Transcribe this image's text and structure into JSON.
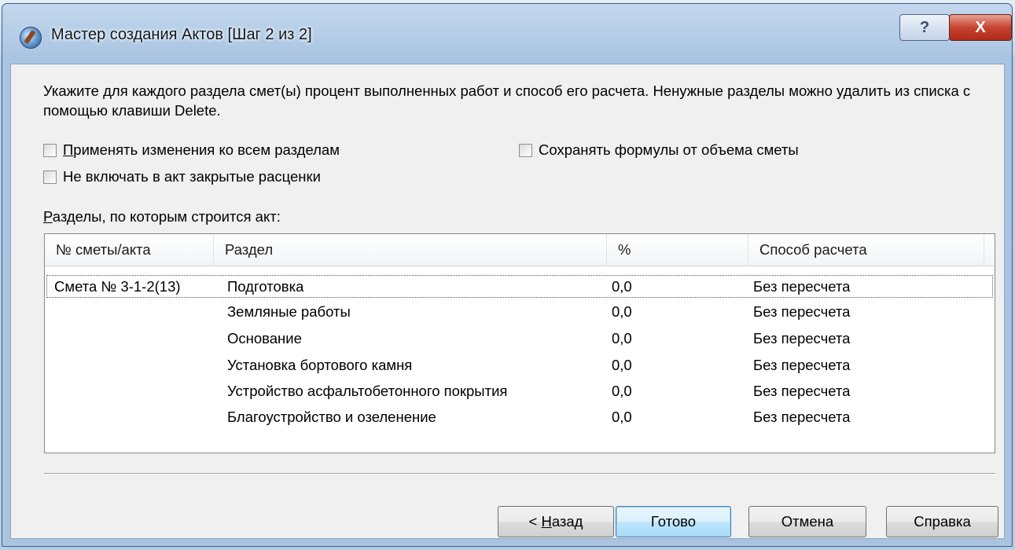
{
  "window": {
    "title": "Мастер создания Актов [Шаг 2 из 2]",
    "help_symbol": "?",
    "close_symbol": "X"
  },
  "instruction": "Укажите для каждого раздела смет(ы) процент выполненных работ и способ его расчета. Ненужные разделы можно удалить из списка с помощью клавиши Delete.",
  "options": {
    "apply_all_first": "П",
    "apply_all_rest": "рименять изменения ко всем разделам",
    "apply_all_checked": false,
    "exclude_closed": "Не включать в акт закрытые расценки",
    "exclude_closed_checked": false,
    "keep_formulas": "Сохранять формулы от объема сметы",
    "keep_formulas_checked": false
  },
  "sections_label_first": "Р",
  "sections_label_rest": "азделы, по которым строится акт:",
  "table": {
    "headers": [
      "№ сметы/акта",
      "Раздел",
      "%",
      "Способ расчета"
    ],
    "rows": [
      {
        "estimate": "Смета № 3-1-2(13)",
        "section": "Подготовка",
        "percent": "0,0",
        "method": "Без пересчета"
      },
      {
        "estimate": "",
        "section": "Земляные работы",
        "percent": "0,0",
        "method": "Без пересчета"
      },
      {
        "estimate": "",
        "section": "Основание",
        "percent": "0,0",
        "method": "Без пересчета"
      },
      {
        "estimate": "",
        "section": "Установка бортового камня",
        "percent": "0,0",
        "method": "Без пересчета"
      },
      {
        "estimate": "",
        "section": "Устройство асфальтобетонного покрытия",
        "percent": "0,0",
        "method": "Без пересчета"
      },
      {
        "estimate": "",
        "section": "Благоустройство и озеленение",
        "percent": "0,0",
        "method": "Без пересчета"
      }
    ]
  },
  "buttons": {
    "back_prefix": "< ",
    "back_underlined": "Н",
    "back_rest": "азад",
    "done": "Готово",
    "cancel": "Отмена",
    "help": "Справка"
  }
}
